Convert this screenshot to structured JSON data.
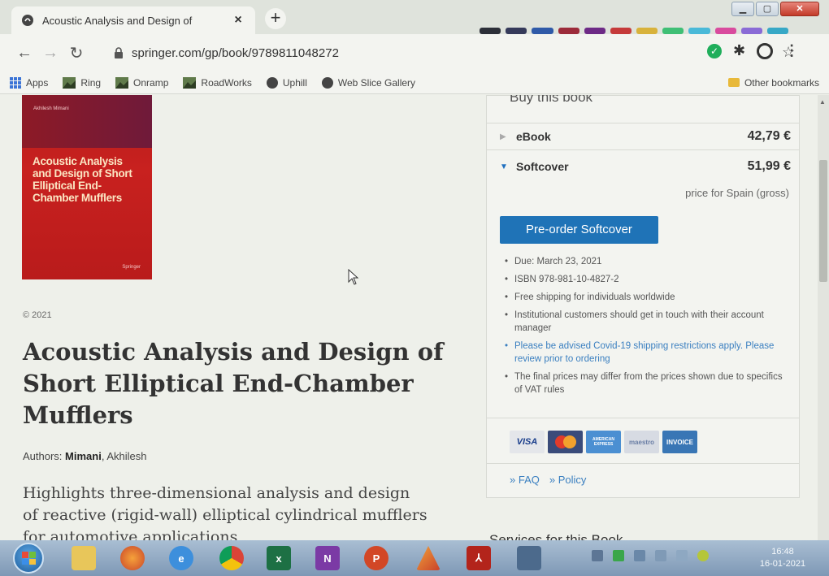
{
  "browser": {
    "tab_title": "Acoustic Analysis and Design of",
    "tab_close": "×",
    "new_tab": "+",
    "url": "springer.com/gp/book/9789811048272",
    "bookmarks": [
      {
        "label": "Apps"
      },
      {
        "label": "Ring"
      },
      {
        "label": "Onramp"
      },
      {
        "label": "RoadWorks"
      },
      {
        "label": "Uphill"
      },
      {
        "label": "Web Slice Gallery"
      }
    ],
    "other_bookmarks": "Other bookmarks"
  },
  "book": {
    "cover": {
      "author": "Akhilesh Mimani",
      "title": "Acoustic Analysis and Design of Short Elliptical End-Chamber Mufflers",
      "publisher": "Springer"
    },
    "copyright": "© 2021",
    "title": "Acoustic Analysis and Design of Short Elliptical End-Chamber Mufflers",
    "authors_label": "Authors:",
    "author_last": "Mimani",
    "author_first": ", Akhilesh",
    "highlights": "Highlights three-dimensional analysis and design of reactive (rigid-wall) elliptical cylindrical mufflers for automotive applications"
  },
  "buy_box": {
    "heading": "Buy this book",
    "ebook": {
      "label": "eBook",
      "price": "42,79 €"
    },
    "softcover": {
      "label": "Softcover",
      "price": "51,99 €"
    },
    "price_note": "price for Spain (gross)",
    "preorder_label": "Pre-order Softcover",
    "info": [
      "Due: March 23, 2021",
      "ISBN 978-981-10-4827-2",
      "Free shipping for individuals worldwide",
      "Institutional customers should get in touch with their account manager",
      "Please be advised Covid-19 shipping restrictions apply. Please review prior to ordering",
      "The final prices may differ from the prices shown due to specifics of VAT rules"
    ],
    "payments": {
      "visa": "VISA",
      "amex": "AMERICAN EXPRESS",
      "maestro": "maestro",
      "invoice": "INVOICE"
    },
    "faq": "» FAQ",
    "policy": "» Policy"
  },
  "services_heading": "Services for this Book",
  "taskbar": {
    "time": "16:48",
    "date": "16-01-2021"
  }
}
